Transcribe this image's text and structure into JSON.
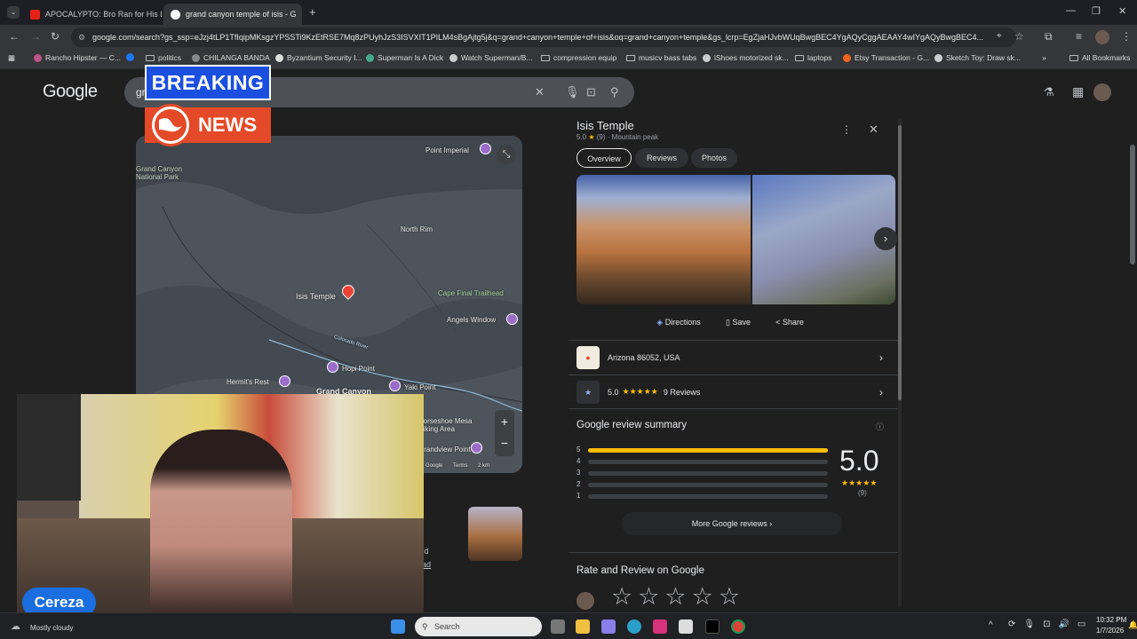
{
  "browser": {
    "tabs": [
      {
        "title": "APOCALYPTO: Bro Ran for His L",
        "active": false
      },
      {
        "title": "grand canyon temple of isis - G",
        "active": true
      }
    ],
    "new_tab": "+",
    "url": "google.com/search?gs_ssp=eJzj4tLP1TfIqipMKsgzYPSSTi9KzEtRSE7Mq8zPUyhJzS3ISVXIT1PILM4sBgAjtg5j&q=grand+canyon+temple+of+isis&oq=grand+canyon+temple&gs_lcrp=EgZjaHJvbWUqBwgBEC4YgAQyCggAEAAY4wIYgAQyBwgBEC4...",
    "bookmarks": [
      {
        "label": "Rancho Hipster — C..."
      },
      {
        "label": "politics"
      },
      {
        "label": "CHILANGA BANDA"
      },
      {
        "label": "Byzantium Security I..."
      },
      {
        "label": "Superman Is A Dick"
      },
      {
        "label": "Watch Superman/B..."
      },
      {
        "label": "compression equip"
      },
      {
        "label": "musicv bass tabs"
      },
      {
        "label": "iShoes motorized sk..."
      },
      {
        "label": "laptops"
      },
      {
        "label": "Etsy Transaction - G..."
      },
      {
        "label": "Sketch Toy: Draw sk..."
      }
    ],
    "all_bookmarks": "All Bookmarks"
  },
  "google": {
    "logo": "Google",
    "search_text": "gr"
  },
  "map": {
    "labels": {
      "park": "Grand Canyon National Park",
      "point_imperial": "Point Imperial",
      "north_rim": "North Rim",
      "isis_temple": "Isis Temple",
      "cape_final": "Cape Final Trailhead",
      "angels_window": "Angels Window",
      "colorado": "Colorado River",
      "hopi_point": "Hopi Point",
      "hermits_rest": "Hermit's Rest",
      "grand_canyon": "Grand Canyon",
      "yaki_point": "Yaki Point",
      "horseshoe": "Horseshoe Mesa Hiking Area",
      "grandview": "Grandview Point",
      "attribution": "Google",
      "terms": "Terms",
      "scale": "2 km"
    },
    "zoom_in": "+",
    "zoom_out": "−"
  },
  "knowledge_panel": {
    "title": "Isis Temple",
    "rating": "5.0",
    "rating_count": "(9)",
    "category": "Mountain peak",
    "tabs": [
      "Overview",
      "Reviews",
      "Photos"
    ],
    "actions": {
      "directions": "Directions",
      "save": "Save",
      "share": "Share"
    },
    "address": "Arizona 86052, USA",
    "reviews_row": {
      "rating": "5.0",
      "stars": "★★★★★",
      "count": "9 Reviews"
    },
    "review_summary": {
      "heading": "Google review summary",
      "bars": [
        {
          "label": "5",
          "fraction": 1.0
        },
        {
          "label": "4",
          "fraction": 0
        },
        {
          "label": "3",
          "fraction": 0
        },
        {
          "label": "2",
          "fraction": 0
        },
        {
          "label": "1",
          "fraction": 0
        }
      ],
      "score": "5.0",
      "stars": "★★★★★",
      "count": "(9)"
    },
    "more_reviews": "More Google reviews",
    "rate_heading": "Rate and Review on Google",
    "empty_stars": "☆☆☆☆☆"
  },
  "partial_result": {
    "line1": "ted",
    "line2": "ead"
  },
  "overlay": {
    "breaking": "BREAKING",
    "news": "NEWS",
    "streamer": "Cereza"
  },
  "taskbar": {
    "weather": "Mostly cloudy",
    "search": "Search",
    "time": "10:32 PM",
    "date": "1/7/2026"
  },
  "colors": {
    "accent_blue": "#8ab4f8",
    "star_yellow": "#fbbc04",
    "breaking_blue": "#1a4fe0",
    "news_red": "#e44a28"
  }
}
